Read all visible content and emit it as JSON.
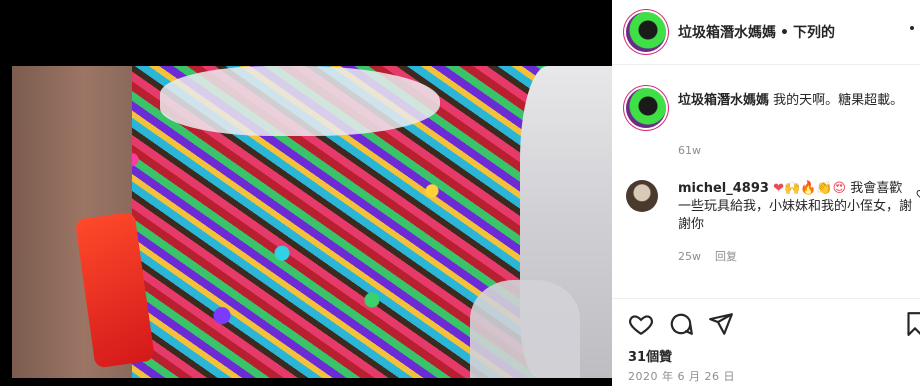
{
  "header": {
    "username": "垃圾箱潛水媽媽",
    "dot": "•",
    "follow_label": "下列的"
  },
  "caption": {
    "username": "垃圾箱潛水媽媽",
    "text": "我的天啊。糖果超載。",
    "time": "61w"
  },
  "comment": {
    "username": "michel_4893",
    "emojis": "❤🙌🔥👏😍",
    "text": "我會喜歡一些玩具給我，小妹妹和我的小侄女，謝謝你",
    "time": "25w",
    "reply_label": "回复"
  },
  "actions": {
    "likes": "31個贊",
    "date": "2020 年 6 月 26 日"
  },
  "colors": {
    "text": "#262626",
    "muted": "#8e8e8e",
    "story_ring": "#d62976",
    "heart_red": "#ed4956"
  },
  "icons": [
    "more-icon",
    "heart-icon",
    "comment-icon",
    "share-icon",
    "bookmark-icon",
    "like-comment-icon"
  ]
}
